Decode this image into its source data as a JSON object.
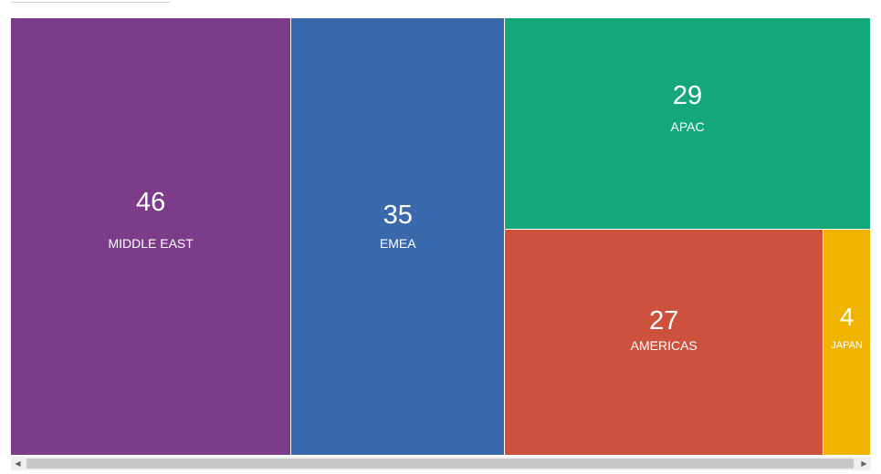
{
  "chart_data": {
    "type": "treemap",
    "items": [
      {
        "label": "MIDDLE EAST",
        "value": 46,
        "color": "#7d3c8a"
      },
      {
        "label": "EMEA",
        "value": 35,
        "color": "#3a68ad"
      },
      {
        "label": "APAC",
        "value": 29,
        "color": "#14a77a"
      },
      {
        "label": "AMERICAS",
        "value": 27,
        "color": "#cc523e"
      },
      {
        "label": "JAPAN",
        "value": 4,
        "color": "#f0b400"
      }
    ]
  },
  "scrollbar": {
    "left_icon": "arrow-left-icon",
    "right_icon": "arrow-right-icon"
  }
}
